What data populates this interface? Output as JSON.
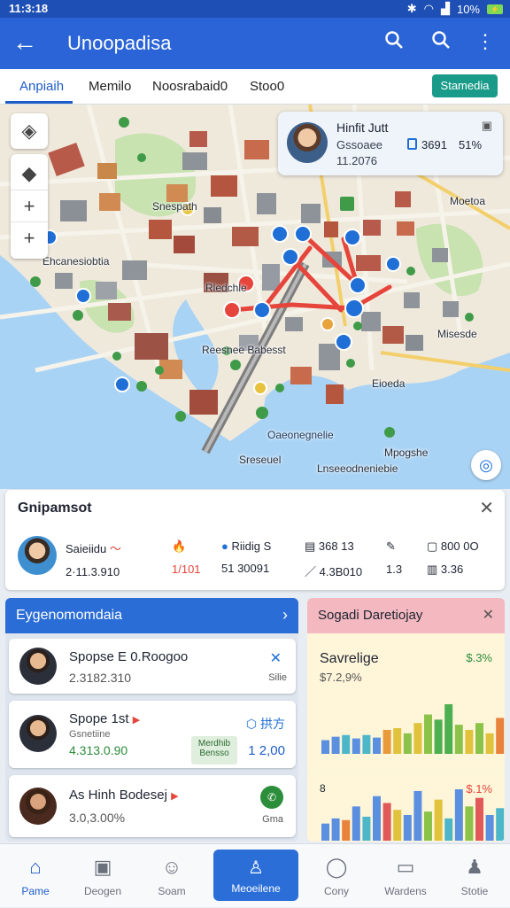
{
  "status_bar": {
    "time": "11:3:18",
    "battery_label": "10%"
  },
  "app_bar": {
    "title": "Unoopadisa",
    "back_icon": "arrow-left-icon",
    "actions": [
      "search-icon",
      "search-icon",
      "more-vert-icon"
    ]
  },
  "tabs": {
    "items": [
      {
        "label": "Anpiaih",
        "active": true
      },
      {
        "label": "Memilo"
      },
      {
        "label": "Noosrabaid0"
      },
      {
        "label": "Stoo0"
      }
    ],
    "action_button": "Stamedia"
  },
  "map": {
    "labels": [
      {
        "text": "Snespath"
      },
      {
        "text": "Ehcanesiobtia"
      },
      {
        "text": "Rledchle"
      },
      {
        "text": "Reesnee Babesst"
      },
      {
        "text": "Moetoa"
      },
      {
        "text": "Misesde"
      },
      {
        "text": "Eioeda"
      },
      {
        "text": "Oaeonegnelie"
      },
      {
        "text": "Sreseuel"
      },
      {
        "text": "Mpogshe"
      },
      {
        "text": "Lnseeodneniebie"
      }
    ],
    "controls": [
      "layers-icon",
      "compass-icon",
      "zoom-in-icon",
      "zoom-in-icon"
    ]
  },
  "profile_card": {
    "name": "Hinfit Jutt",
    "line1": "Gssoaee",
    "line2": "11.2076",
    "stat_label": "3691",
    "stat_value": "51%",
    "badge_icon": "phone-icon",
    "top_icon": "briefcase-icon"
  },
  "summary": {
    "title": "Gnipamsot",
    "stats": [
      {
        "top": "Saieiidu",
        "bottom": "2·11.3.910"
      },
      {
        "top": "",
        "bottom": "1/101"
      },
      {
        "top": "Riidig S",
        "bottom": "51 30091"
      },
      {
        "top": "368 13",
        "bottom": "4.3B010"
      },
      {
        "top": "",
        "bottom": "1.3"
      },
      {
        "top": "800 0O",
        "bottom": "3.36"
      }
    ]
  },
  "list_panel": {
    "title": "Eygenomomdaia",
    "items": [
      {
        "name": "Spopse E 0.Roogoo",
        "value": "2.3182.310",
        "action": "Silie"
      },
      {
        "name": "Spope 1st",
        "sub": "Gsnetiine",
        "value": "4.313.0.90",
        "badge": "Merdhib Bensso",
        "right_value": "1 2,00",
        "right_label": "拱方"
      },
      {
        "name": "As Hinh Bodesej",
        "value": "3.0,3.00%",
        "action": "Gma"
      }
    ]
  },
  "chart_panel": {
    "title": "Sogadi Daretiojay",
    "card1_title": "Savrelige",
    "card1_sub": "$7.2,9%",
    "card1_pct": "$.3%",
    "card2_label": "8",
    "card2_pct": "$.1%"
  },
  "chart_data": [
    {
      "type": "bar",
      "title": "Savrelige",
      "values": [
        16,
        20,
        22,
        18,
        22,
        19,
        28,
        30,
        24,
        36,
        46,
        40,
        58,
        34,
        28,
        36,
        24,
        42
      ],
      "colors": [
        "#5b8fe0",
        "#5b8fe0",
        "#4db6c9",
        "#5b8fe0",
        "#4db6c9",
        "#5b8fe0",
        "#e89a3c",
        "#e0c23c",
        "#8bc34a",
        "#e0c23c",
        "#8bc34a",
        "#4caf50",
        "#4caf50",
        "#8bc34a",
        "#e0c23c",
        "#8bc34a",
        "#e0c23c",
        "#e8823c"
      ],
      "ylim": [
        0,
        60
      ]
    },
    {
      "type": "bar",
      "title": "8",
      "values": [
        20,
        26,
        24,
        40,
        28,
        52,
        44,
        36,
        30,
        58,
        34,
        48,
        26,
        60,
        40,
        50,
        30,
        38
      ],
      "colors": [
        "#5b8fe0",
        "#5b8fe0",
        "#e8823c",
        "#5b8fe0",
        "#4db6c9",
        "#5b8fe0",
        "#e05a5a",
        "#e0c23c",
        "#5b8fe0",
        "#5b8fe0",
        "#8bc34a",
        "#e0c23c",
        "#4db6c9",
        "#5b8fe0",
        "#8bc34a",
        "#e05a5a",
        "#5b8fe0",
        "#4db6c9"
      ],
      "ylim": [
        0,
        60
      ]
    }
  ],
  "bottom_nav": {
    "items": [
      {
        "label": "Pame",
        "icon": "home-icon"
      },
      {
        "label": "Deogen",
        "icon": "calendar-icon"
      },
      {
        "label": "Soam",
        "icon": "people-icon"
      },
      {
        "label": "Meoeilene",
        "icon": "user-icon"
      },
      {
        "label": "Cony",
        "icon": "chat-icon"
      },
      {
        "label": "Wardens",
        "icon": "message-icon"
      },
      {
        "label": "Stotie",
        "icon": "person-icon"
      }
    ]
  }
}
